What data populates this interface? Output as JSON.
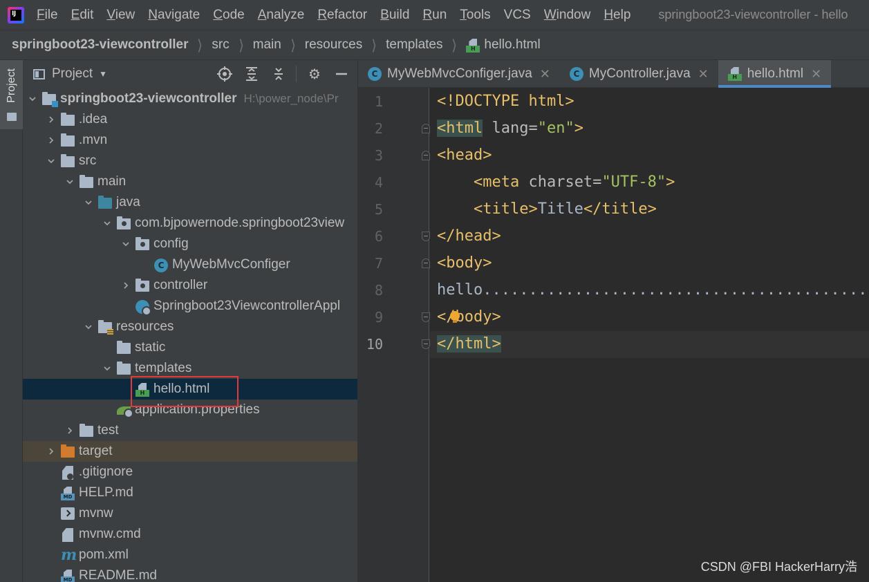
{
  "menu": {
    "app_logo_text": "IJ",
    "items": [
      "File",
      "Edit",
      "View",
      "Navigate",
      "Code",
      "Analyze",
      "Refactor",
      "Build",
      "Run",
      "Tools",
      "VCS",
      "Window",
      "Help"
    ],
    "window_title": "springboot23-viewcontroller - hello"
  },
  "breadcrumb": [
    "springboot23-viewcontroller",
    "src",
    "main",
    "resources",
    "templates",
    "hello.html"
  ],
  "tool_strip": {
    "project_tab": "Project"
  },
  "project_panel": {
    "title": "Project",
    "tree": [
      {
        "label": "springboot23-viewcontroller",
        "hint": "H:\\power_node\\Pr",
        "depth": 0,
        "arrow": "down",
        "icon": "module-folder",
        "bold": true
      },
      {
        "label": ".idea",
        "depth": 1,
        "arrow": "right",
        "icon": "folder"
      },
      {
        "label": ".mvn",
        "depth": 1,
        "arrow": "right",
        "icon": "folder"
      },
      {
        "label": "src",
        "depth": 1,
        "arrow": "down",
        "icon": "folder"
      },
      {
        "label": "main",
        "depth": 2,
        "arrow": "down",
        "icon": "folder"
      },
      {
        "label": "java",
        "depth": 3,
        "arrow": "down",
        "icon": "source-folder"
      },
      {
        "label": "com.bjpowernode.springboot23view",
        "depth": 4,
        "arrow": "down",
        "icon": "package"
      },
      {
        "label": "config",
        "depth": 5,
        "arrow": "down",
        "icon": "package"
      },
      {
        "label": "MyWebMvcConfiger",
        "depth": 6,
        "arrow": "none",
        "icon": "class"
      },
      {
        "label": "controller",
        "depth": 5,
        "arrow": "right",
        "icon": "package"
      },
      {
        "label": "Springboot23ViewcontrollerAppl",
        "depth": 5,
        "arrow": "none",
        "icon": "spring-class"
      },
      {
        "label": "resources",
        "depth": 3,
        "arrow": "down",
        "icon": "resources-folder"
      },
      {
        "label": "static",
        "depth": 4,
        "arrow": "none",
        "icon": "folder"
      },
      {
        "label": "templates",
        "depth": 4,
        "arrow": "down",
        "icon": "folder"
      },
      {
        "label": "hello.html",
        "depth": 5,
        "arrow": "none",
        "icon": "html-file",
        "state": "selected"
      },
      {
        "label": "application.properties",
        "depth": 4,
        "arrow": "none",
        "icon": "properties-file"
      },
      {
        "label": "test",
        "depth": 2,
        "arrow": "right",
        "icon": "folder"
      },
      {
        "label": "target",
        "depth": 1,
        "arrow": "right",
        "icon": "excluded-folder",
        "state": "excluded"
      },
      {
        "label": ".gitignore",
        "depth": 1,
        "arrow": "none",
        "icon": "ignore-file"
      },
      {
        "label": "HELP.md",
        "depth": 1,
        "arrow": "none",
        "icon": "markdown-file"
      },
      {
        "label": "mvnw",
        "depth": 1,
        "arrow": "none",
        "icon": "shell-file"
      },
      {
        "label": "mvnw.cmd",
        "depth": 1,
        "arrow": "none",
        "icon": "text-file"
      },
      {
        "label": "pom.xml",
        "depth": 1,
        "arrow": "none",
        "icon": "maven-file"
      },
      {
        "label": "README.md",
        "depth": 1,
        "arrow": "none",
        "icon": "markdown-file"
      }
    ]
  },
  "editor": {
    "tabs": [
      {
        "label": "MyWebMvcConfiger.java",
        "icon": "class",
        "active": false
      },
      {
        "label": "MyController.java",
        "icon": "class",
        "active": false
      },
      {
        "label": "hello.html",
        "icon": "html-file",
        "active": true
      }
    ],
    "current_line": 10,
    "line_numbers": [
      "1",
      "2",
      "3",
      "4",
      "5",
      "6",
      "7",
      "8",
      "9",
      "10"
    ],
    "lines": [
      [
        {
          "t": "<!DOCTYPE html>",
          "c": "tag"
        }
      ],
      [
        {
          "t": "<html",
          "c": "tag match"
        },
        {
          "t": " lang=",
          "c": "attr"
        },
        {
          "t": "\"en\"",
          "c": "str"
        },
        {
          "t": ">",
          "c": "tag"
        }
      ],
      [
        {
          "t": "<head>",
          "c": "tag"
        }
      ],
      [
        {
          "t": "    <meta",
          "c": "tag"
        },
        {
          "t": " charset=",
          "c": "attr"
        },
        {
          "t": "\"UTF-8\"",
          "c": "str"
        },
        {
          "t": ">",
          "c": "tag"
        }
      ],
      [
        {
          "t": "    <title>",
          "c": "tag"
        },
        {
          "t": "Title",
          "c": "txt"
        },
        {
          "t": "</title>",
          "c": "tag"
        }
      ],
      [
        {
          "t": "</head>",
          "c": "tag"
        }
      ],
      [
        {
          "t": "<body>",
          "c": "tag"
        }
      ],
      [
        {
          "t": "hello..........................................",
          "c": "txt"
        }
      ],
      [
        {
          "t": "</body>",
          "c": "tag"
        }
      ],
      [
        {
          "t": "</html>",
          "c": "tag match"
        }
      ]
    ]
  },
  "watermark": "CSDN @FBI HackerHarry浩",
  "colors": {
    "background": "#2b2b2b",
    "panel": "#3c3f41",
    "selection": "#0d293e",
    "accent": "#4a88c7",
    "highlight_box": "#e13b3b"
  }
}
